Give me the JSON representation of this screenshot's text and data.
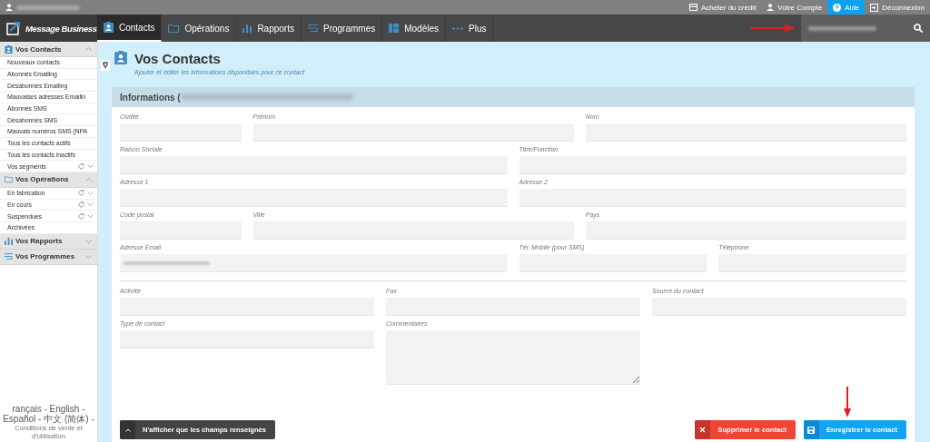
{
  "top_bar": {
    "links": [
      {
        "label": "Acheter du crédit",
        "highlighted": false
      },
      {
        "label": "Votre Compte",
        "highlighted": false
      },
      {
        "label": "Aide",
        "highlighted": true
      },
      {
        "label": "Déconnexion",
        "highlighted": false
      }
    ]
  },
  "nav": {
    "logo": "Message Business",
    "tabs": [
      {
        "label": "Contacts",
        "selected": true
      },
      {
        "label": "Opérations",
        "selected": false
      },
      {
        "label": "Rapports",
        "selected": false
      },
      {
        "label": "Programmes",
        "selected": false
      },
      {
        "label": "Modèles",
        "selected": false
      },
      {
        "label": "Plus",
        "selected": false
      }
    ]
  },
  "sidebar": {
    "sections": [
      {
        "title": "Vos Contacts",
        "expanded": true,
        "items": [
          {
            "label": "Nouveaux contacts",
            "kind": "plain"
          },
          {
            "label": "Abonnés Emailing",
            "kind": "plain"
          },
          {
            "label": "Désabonnés Emailing",
            "kind": "plain"
          },
          {
            "label": "Mauvaises adresses Emailin",
            "kind": "plain"
          },
          {
            "label": "Abonnés SMS",
            "kind": "plain"
          },
          {
            "label": "Désabonnés SMS",
            "kind": "plain"
          },
          {
            "label": "Mauvais numéros SMS (NPA",
            "kind": "plain"
          },
          {
            "label": "Tous les contacts actifs",
            "kind": "plain"
          },
          {
            "label": "Tous les contacts inactifs",
            "kind": "plain"
          },
          {
            "label": "Vos segments",
            "kind": "refreshable"
          }
        ]
      },
      {
        "title": "Vos Opérations",
        "expanded": true,
        "items": [
          {
            "label": "En fabrication",
            "kind": "refreshable"
          },
          {
            "label": "En cours",
            "kind": "refreshable"
          },
          {
            "label": "Suspendues",
            "kind": "refreshable"
          },
          {
            "label": "Archivées",
            "kind": "plain"
          }
        ]
      },
      {
        "title": "Vos Rapports",
        "expanded": false
      },
      {
        "title": "Vos Programmes",
        "expanded": false
      }
    ],
    "footer": {
      "languages": "rançais - English - Español - 中文 (简体) -",
      "terms": "Conditions de vente et d'utilisation"
    }
  },
  "page": {
    "title": "Vos Contacts",
    "subtitle": "Ajouter et éditer les informations disponibles pour ce contact",
    "card_title": "Informations (",
    "field_rows": [
      [
        {
          "label": "Civilité",
          "kind": "input"
        },
        {
          "label": "Prénom",
          "kind": "input"
        },
        {
          "label": "Nom",
          "kind": "input"
        }
      ],
      [
        {
          "label": "Raison Sociale",
          "kind": "input"
        },
        {
          "label": "Titre/Fonction",
          "kind": "input"
        }
      ],
      [
        {
          "label": "Adresse 1",
          "kind": "input"
        },
        {
          "label": "Adresse 2",
          "kind": "input"
        }
      ],
      [
        {
          "label": "Code postal",
          "kind": "input"
        },
        {
          "label": "Ville",
          "kind": "input"
        },
        {
          "label": "Pays",
          "kind": "input"
        }
      ],
      [
        {
          "label": "Adresse Email",
          "kind": "redacted"
        },
        {
          "label": "Tél. Mobile (pour SMS)",
          "kind": "input"
        },
        {
          "label": "Téléphone",
          "kind": "input"
        }
      ],
      [
        {
          "label": "Activité",
          "kind": "input"
        },
        {
          "label": "Fax",
          "kind": "input"
        },
        {
          "label": "Source du contact",
          "kind": "input"
        }
      ],
      [
        {
          "label": "Type de contact",
          "kind": "input"
        },
        {
          "label": "Commentaires",
          "kind": "textarea"
        }
      ]
    ],
    "toggle_button": "N'afficher que les champs renseignés",
    "buttons": [
      {
        "label": "Supprimer le contact",
        "kind": "delete"
      },
      {
        "label": "Enregistrer le contact",
        "kind": "save"
      }
    ]
  }
}
